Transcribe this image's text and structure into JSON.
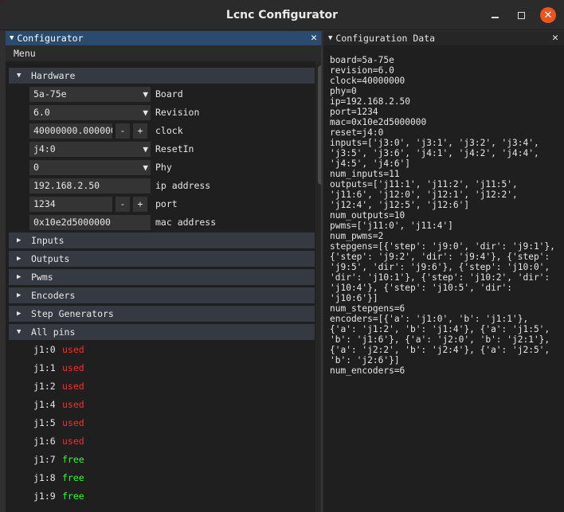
{
  "window": {
    "title": "Lcnc Configurator"
  },
  "left_panel": {
    "title": "Configurator",
    "menu": "Menu",
    "hardware": {
      "label": "Hardware",
      "rows": [
        {
          "value": "5a-75e",
          "label": "Board",
          "kind": "combo"
        },
        {
          "value": "6.0",
          "label": "Revision",
          "kind": "combo"
        },
        {
          "value": "40000000.000000",
          "label": "clock",
          "kind": "stepper"
        },
        {
          "value": "j4:0",
          "label": "ResetIn",
          "kind": "combo"
        },
        {
          "value": "0",
          "label": "Phy",
          "kind": "combo"
        },
        {
          "value": "192.168.2.50",
          "label": "ip address",
          "kind": "text"
        },
        {
          "value": "1234",
          "label": "port",
          "kind": "stepper"
        },
        {
          "value": "0x10e2d5000000",
          "label": "mac address",
          "kind": "text"
        }
      ]
    },
    "sections": [
      "Inputs",
      "Outputs",
      "Pwms",
      "Encoders",
      "Step Generators"
    ],
    "all_pins": {
      "label": "All pins",
      "pins": [
        {
          "name": "j1:0",
          "status": "used"
        },
        {
          "name": "j1:1",
          "status": "used"
        },
        {
          "name": "j1:2",
          "status": "used"
        },
        {
          "name": "j1:4",
          "status": "used"
        },
        {
          "name": "j1:5",
          "status": "used"
        },
        {
          "name": "j1:6",
          "status": "used"
        },
        {
          "name": "j1:7",
          "status": "free"
        },
        {
          "name": "j1:8",
          "status": "free"
        },
        {
          "name": "j1:9",
          "status": "free"
        }
      ]
    },
    "stepper_minus": "-",
    "stepper_plus": "+"
  },
  "right_panel": {
    "title": "Configuration Data",
    "lines": [
      "board=5a-75e",
      "revision=6.0",
      "clock=40000000",
      "phy=0",
      "ip=192.168.2.50",
      "port=1234",
      "mac=0x10e2d5000000",
      "reset=j4:0",
      "inputs=['j3:0', 'j3:1', 'j3:2', 'j3:4',",
      "'j3:5', 'j3:6', 'j4:1', 'j4:2', 'j4:4',",
      "'j4:5', 'j4:6']",
      "num_inputs=11",
      "outputs=['j11:1', 'j11:2', 'j11:5',",
      "'j11:6', 'j12:0', 'j12:1', 'j12:2',",
      "'j12:4', 'j12:5', 'j12:6']",
      "num_outputs=10",
      "pwms=['j11:0', 'j11:4']",
      "num_pwms=2",
      "stepgens=[{'step': 'j9:0', 'dir': 'j9:1'},",
      "{'step': 'j9:2', 'dir': 'j9:4'}, {'step':",
      "'j9:5', 'dir': 'j9:6'}, {'step': 'j10:0',",
      "'dir': 'j10:1'}, {'step': 'j10:2', 'dir':",
      "'j10:4'}, {'step': 'j10:5', 'dir':",
      "'j10:6'}]",
      "num_stepgens=6",
      "encoders=[{'a': 'j1:0', 'b': 'j1:1'},",
      "{'a': 'j1:2', 'b': 'j1:4'}, {'a': 'j1:5',",
      "'b': 'j1:6'}, {'a': 'j2:0', 'b': 'j2:1'},",
      "{'a': 'j2:2', 'b': 'j2:4'}, {'a': 'j2:5',",
      "'b': 'j2:6'}]",
      "num_encoders=6"
    ]
  },
  "colors": {
    "used": "#ff2a2a",
    "free": "#2dff2d",
    "title_active": "#2a4b6e",
    "close_button": "#e95420"
  }
}
